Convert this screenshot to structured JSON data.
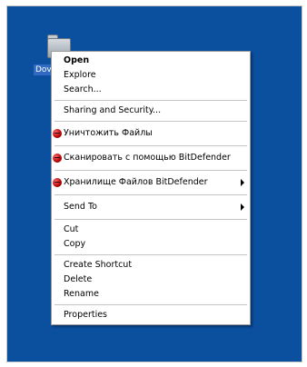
{
  "desktop": {
    "icon": {
      "name": "folder-icon",
      "label": "Dov"
    }
  },
  "menu": {
    "open": "Open",
    "explore": "Explore",
    "search": "Search...",
    "sharing": "Sharing and Security...",
    "destroy": "Уничтожить Файлы",
    "scan": "Сканировать с помощью BitDefender",
    "vault": "Хранилище Файлов BitDefender",
    "send_to": "Send To",
    "cut": "Cut",
    "copy": "Copy",
    "create_shortcut": "Create Shortcut",
    "delete": "Delete",
    "rename": "Rename",
    "properties": "Properties"
  },
  "colors": {
    "desktop": "#0b4f9f",
    "selection": "#316ac5",
    "bitdefender": "#b40000"
  }
}
